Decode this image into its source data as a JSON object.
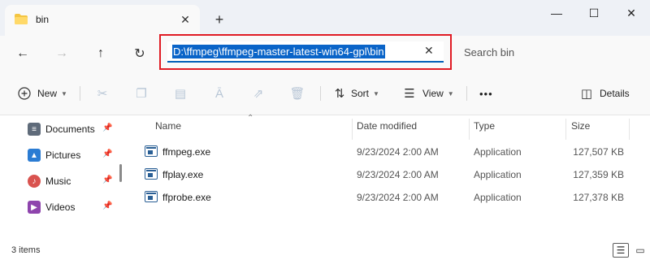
{
  "tab": {
    "title": "bin",
    "close": "✕",
    "new_tab": "+"
  },
  "window": {
    "minimize": "—",
    "maximize": "☐",
    "close": "✕"
  },
  "nav": {
    "back": "←",
    "forward": "→",
    "up": "↑",
    "refresh": "↻"
  },
  "address": {
    "path": "D:\\ffmpeg\\ffmpeg-master-latest-win64-gpl\\bin",
    "clear": "✕"
  },
  "search": {
    "placeholder": "Search bin"
  },
  "toolbar": {
    "new_label": "New",
    "sort_label": "Sort",
    "view_label": "View",
    "more": "•••",
    "details_label": "Details"
  },
  "sidebar": {
    "items": [
      {
        "label": "Documents",
        "color": "#5f6b7a"
      },
      {
        "label": "Pictures",
        "color": "#2b7cd3"
      },
      {
        "label": "Music",
        "color": "#d9534f"
      },
      {
        "label": "Videos",
        "color": "#8e44ad"
      }
    ]
  },
  "columns": {
    "name": "Name",
    "date": "Date modified",
    "type": "Type",
    "size": "Size"
  },
  "files": [
    {
      "name": "ffmpeg.exe",
      "date": "9/23/2024 2:00 AM",
      "type": "Application",
      "size": "127,507 KB"
    },
    {
      "name": "ffplay.exe",
      "date": "9/23/2024 2:00 AM",
      "type": "Application",
      "size": "127,359 KB"
    },
    {
      "name": "ffprobe.exe",
      "date": "9/23/2024 2:00 AM",
      "type": "Application",
      "size": "127,378 KB"
    }
  ],
  "status": {
    "count": "3 items"
  },
  "colors": {
    "accent": "#005fb8",
    "selection": "#0a64c8",
    "highlight_border": "#e01b24"
  }
}
